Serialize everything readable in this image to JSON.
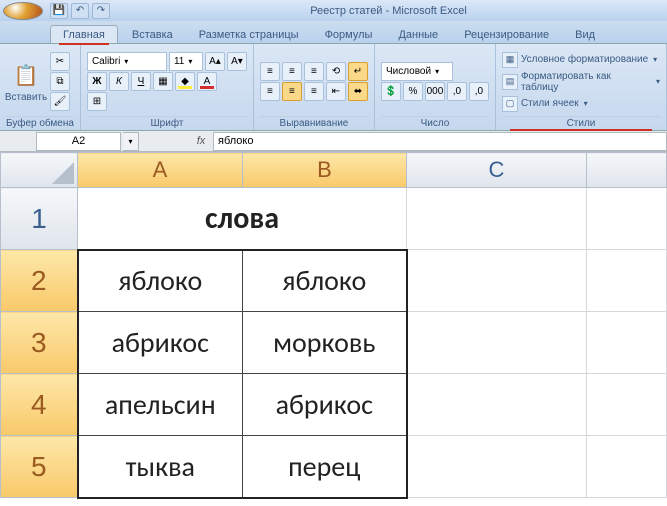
{
  "title": "Реестр статей - Microsoft Excel",
  "tabs": [
    "Главная",
    "Вставка",
    "Разметка страницы",
    "Формулы",
    "Данные",
    "Рецензирование",
    "Вид"
  ],
  "active_tab": 0,
  "ribbon": {
    "clipboard": {
      "paste": "Вставить",
      "label": "Буфер обмена"
    },
    "font": {
      "name": "Calibri",
      "size": "11",
      "label": "Шрифт"
    },
    "align": {
      "label": "Выравнивание"
    },
    "number": {
      "format": "Числовой",
      "label": "Число"
    },
    "styles": {
      "cond_format": "Условное форматирование",
      "table_format": "Форматировать как таблицу",
      "cell_styles": "Стили ячеек",
      "label": "Стили"
    }
  },
  "name_box": "A2",
  "formula": "яблоко",
  "col_headers": [
    "A",
    "B",
    "C",
    ""
  ],
  "row_headers": [
    "1",
    "2",
    "3",
    "4",
    "5"
  ],
  "cells": {
    "header_merged": "слова",
    "r2": {
      "a": "яблоко",
      "b": "яблоко"
    },
    "r3": {
      "a": "абрикос",
      "b": "морковь"
    },
    "r4": {
      "a": "апельсин",
      "b": "абрикос"
    },
    "r5": {
      "a": "тыква",
      "b": "перец"
    }
  }
}
